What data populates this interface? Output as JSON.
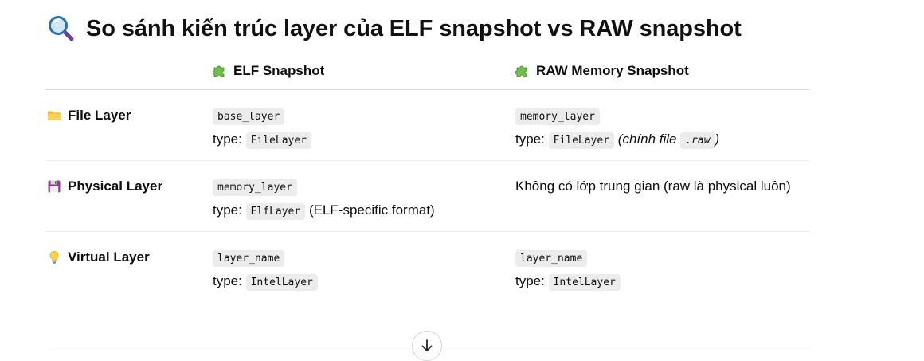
{
  "title": "So sánh kiến trúc layer của ELF snapshot vs RAW snapshot",
  "title_icon": "magnifying-glass-icon",
  "table": {
    "headers": [
      {
        "label": "",
        "icon": null
      },
      {
        "label": "ELF Snapshot",
        "icon": "puzzle-piece-icon"
      },
      {
        "label": "RAW Memory Snapshot",
        "icon": "puzzle-piece-icon"
      }
    ],
    "rows": [
      {
        "label": "File Layer",
        "icon": "folder-icon",
        "elf": {
          "code": "base_layer",
          "type_prefix": "type:",
          "type_code": "FileLayer"
        },
        "raw": {
          "code": "memory_layer",
          "type_prefix": "type:",
          "type_code": "FileLayer",
          "note_open": "(chính file",
          "note_code": ".raw",
          "note_close": ")"
        }
      },
      {
        "label": "Physical Layer",
        "icon": "floppy-disk-icon",
        "elf": {
          "code": "memory_layer",
          "type_prefix": "type:",
          "type_code": "ElfLayer",
          "type_note": "(ELF-specific format)"
        },
        "raw": {
          "text": "Không có lớp trung gian (raw là physical luôn)"
        }
      },
      {
        "label": "Virtual Layer",
        "icon": "light-bulb-icon",
        "elf": {
          "code": "layer_name",
          "type_prefix": "type:",
          "type_code": "IntelLayer"
        },
        "raw": {
          "code": "layer_name",
          "type_prefix": "type:",
          "type_code": "IntelLayer"
        }
      }
    ]
  },
  "scroll_button_icon": "arrow-down-icon",
  "colors": {
    "text": "#0d0d0d",
    "code_bg": "#ececec",
    "divider": "#d9d9d9"
  }
}
